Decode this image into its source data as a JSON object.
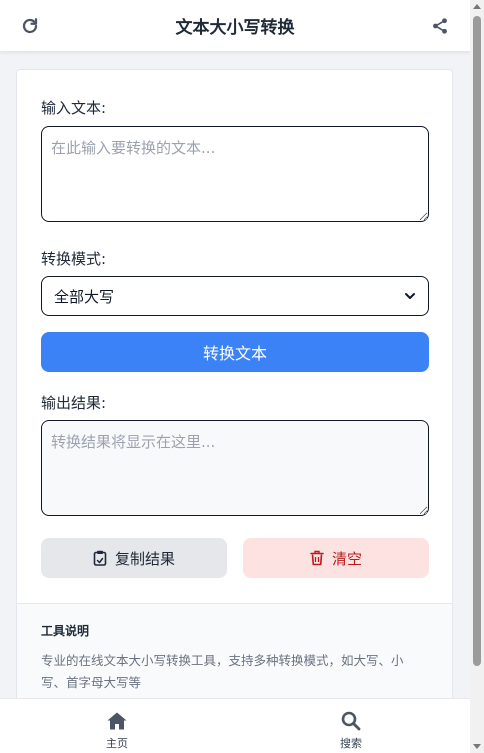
{
  "header": {
    "title": "文本大小写转换",
    "refresh_icon": "refresh-icon",
    "share_icon": "share-icon"
  },
  "form": {
    "input_label": "输入文本:",
    "input_placeholder": "在此输入要转换的文本...",
    "input_value": "",
    "mode_label": "转换模式:",
    "mode_selected": "全部大写",
    "convert_button": "转换文本",
    "output_label": "输出结果:",
    "output_placeholder": "转换结果将显示在这里...",
    "output_value": "",
    "copy_button": "复制结果",
    "clear_button": "清空"
  },
  "info": {
    "title": "工具说明",
    "description": "专业的在线文本大小写转换工具，支持多种转换模式，如大写、小写、首字母大写等"
  },
  "bottom_nav": {
    "items": [
      {
        "label": "主页",
        "icon": "home-icon"
      },
      {
        "label": "搜索",
        "icon": "search-icon"
      }
    ]
  },
  "colors": {
    "primary": "#3b82f6",
    "danger_bg": "#fde2e2",
    "danger_text": "#b91c1c",
    "neutral_button": "#e5e7eb"
  }
}
